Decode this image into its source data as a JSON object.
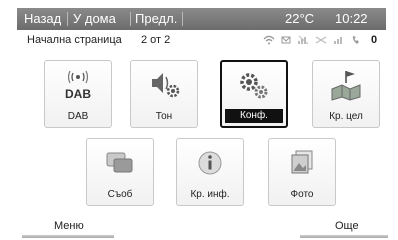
{
  "topbar": {
    "back": "Назад",
    "home": "У дома",
    "prev": "Предл.",
    "temperature": "22°C",
    "time": "10:22"
  },
  "subbar": {
    "page_title": "Начална страница",
    "page_count": "2 от 2",
    "badge": "0"
  },
  "tiles": [
    {
      "label": "DAB",
      "icon_text": "DAB",
      "icon": "dab-radio-icon",
      "selected": false
    },
    {
      "label": "Тон",
      "icon": "tone-settings-icon",
      "selected": false
    },
    {
      "label": "Конф.",
      "icon": "config-gears-icon",
      "selected": true
    },
    {
      "label": "Кр. цел",
      "icon": "destination-map-icon",
      "selected": false
    },
    {
      "label": "Съоб",
      "icon": "messages-icon",
      "selected": false
    },
    {
      "label": "Кр. инф.",
      "icon": "info-icon",
      "selected": false
    },
    {
      "label": "Фото",
      "icon": "photo-icon",
      "selected": false
    }
  ],
  "bottom": {
    "menu": "Меню",
    "more": "Още"
  }
}
